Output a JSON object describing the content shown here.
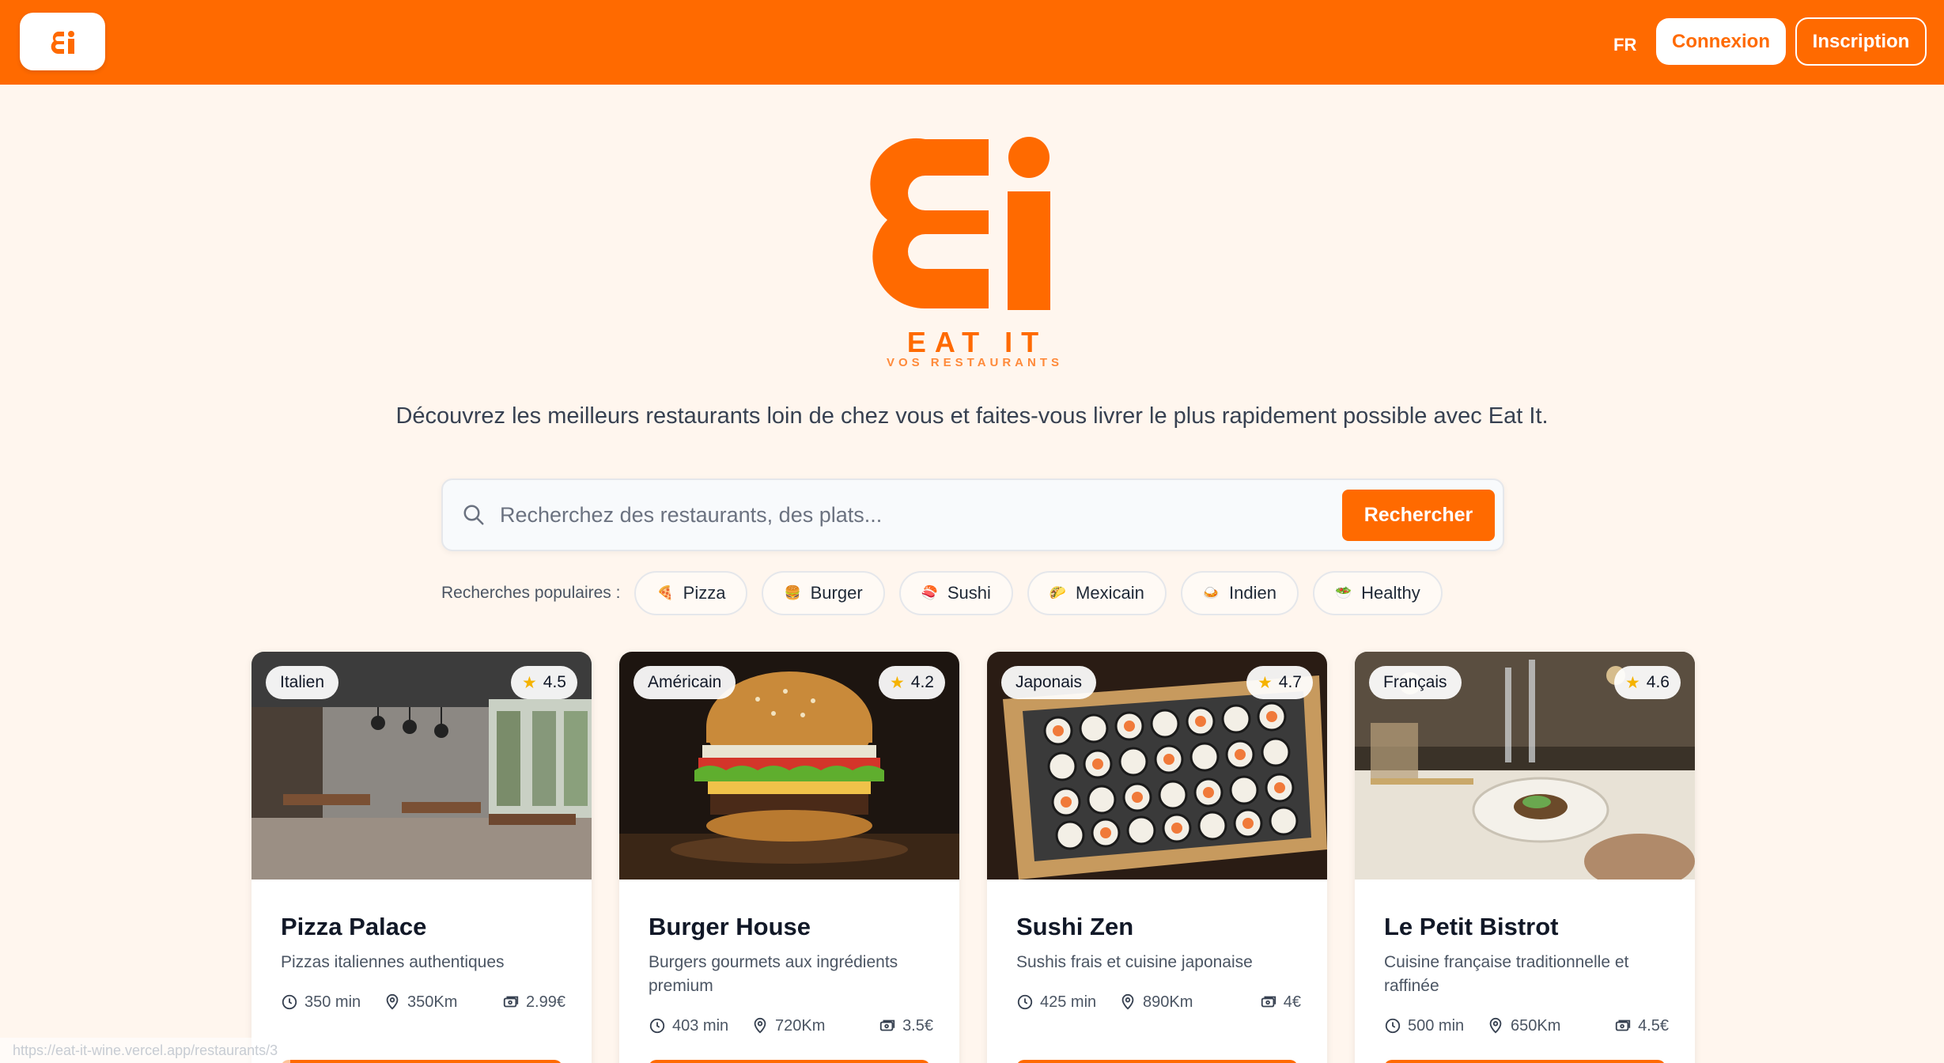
{
  "header": {
    "logo_text": "Ei",
    "language": "FR",
    "login_label": "Connexion",
    "signup_label": "Inscription"
  },
  "hero": {
    "brand_name": "EAT IT",
    "brand_subtitle": "VOS RESTAURANTS",
    "tagline": "Découvrez les meilleurs restaurants loin de chez vous et faites-vous livrer le plus rapidement possible avec Eat It."
  },
  "search": {
    "placeholder": "Recherchez des restaurants, des plats...",
    "button_label": "Rechercher",
    "popular_label": "Recherches populaires :",
    "chips": [
      {
        "label": "Pizza",
        "icon": "pizza-icon",
        "emoji": "🍕"
      },
      {
        "label": "Burger",
        "icon": "burger-icon",
        "emoji": "🍔"
      },
      {
        "label": "Sushi",
        "icon": "sushi-icon",
        "emoji": "🍣"
      },
      {
        "label": "Mexicain",
        "icon": "taco-icon",
        "emoji": "🌮"
      },
      {
        "label": "Indien",
        "icon": "curry-icon",
        "emoji": "🍛"
      },
      {
        "label": "Healthy",
        "icon": "salad-icon",
        "emoji": "🥗"
      }
    ]
  },
  "restaurants": [
    {
      "category": "Italien",
      "rating": "4.5",
      "name": "Pizza Palace",
      "description": "Pizzas italiennes authentiques",
      "time": "350 min",
      "distance": "350Km",
      "delivery_fee": "2.99€"
    },
    {
      "category": "Américain",
      "rating": "4.2",
      "name": "Burger House",
      "description": "Burgers gourmets aux ingrédients premium",
      "time": "403 min",
      "distance": "720Km",
      "delivery_fee": "3.5€"
    },
    {
      "category": "Japonais",
      "rating": "4.7",
      "name": "Sushi Zen",
      "description": "Sushis frais et cuisine japonaise",
      "time": "425 min",
      "distance": "890Km",
      "delivery_fee": "4€"
    },
    {
      "category": "Français",
      "rating": "4.6",
      "name": "Le Petit Bistrot",
      "description": "Cuisine française traditionnelle et raffinée",
      "time": "500 min",
      "distance": "650Km",
      "delivery_fee": "4.5€"
    }
  ],
  "status_bar": {
    "url": "https://eat-it-wine.vercel.app/restaurants/3"
  },
  "colors": {
    "brand": "#ff6a00",
    "background": "#fff6ee",
    "star": "#f5b301"
  }
}
